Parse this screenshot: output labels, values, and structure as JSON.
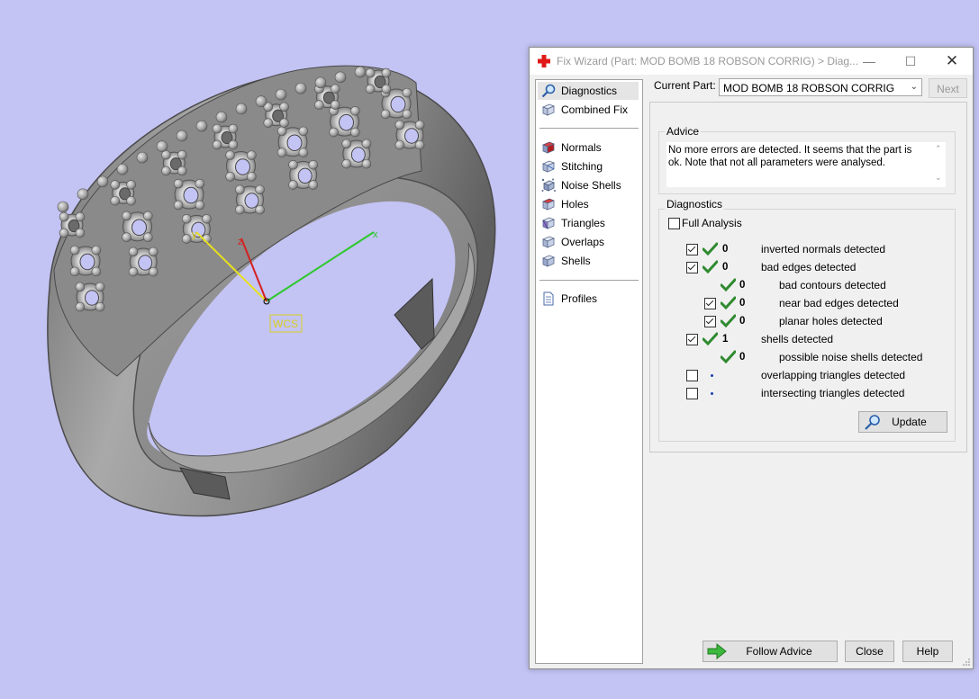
{
  "viewport": {
    "wcs_label": "WCS",
    "axis_x_label": "x",
    "axis_y_label": "y",
    "axis_z_label": "z"
  },
  "dialog": {
    "title": "Fix Wizard (Part: MOD  BOMB 18 ROBSON CORRIG) > Diag...",
    "nav": [
      {
        "label": "Diagnostics",
        "icon": "magnifier-icon",
        "selected": true
      },
      {
        "label": "Combined Fix",
        "icon": "cube-icon"
      },
      {
        "label": "Normals",
        "icon": "normals-cube-icon"
      },
      {
        "label": "Stitching",
        "icon": "stitching-cube-icon"
      },
      {
        "label": "Noise Shells",
        "icon": "noise-shells-icon"
      },
      {
        "label": "Holes",
        "icon": "holes-cube-icon"
      },
      {
        "label": "Triangles",
        "icon": "triangles-cube-icon"
      },
      {
        "label": "Overlaps",
        "icon": "overlaps-cube-icon"
      },
      {
        "label": "Shells",
        "icon": "shells-cube-icon"
      },
      {
        "label": "Profiles",
        "icon": "document-icon"
      }
    ],
    "current_part_label": "Current Part:",
    "current_part_value": "MOD  BOMB 18 ROBSON CORRIG",
    "next_label": "Next",
    "advice": {
      "title": "Advice",
      "text": "No more errors are detected. It seems that the part is ok. Note that not all parameters were analysed."
    },
    "diagnostics": {
      "title": "Diagnostics",
      "full_analysis_label": "Full Analysis",
      "full_analysis_checked": false,
      "rows": [
        {
          "checked": true,
          "status": "ok",
          "count": "0",
          "label": "inverted normals detected"
        },
        {
          "checked": true,
          "status": "ok",
          "count": "0",
          "label": "bad edges detected"
        },
        {
          "status": "ok",
          "count": "0",
          "label": "bad contours detected"
        },
        {
          "checked": true,
          "status": "ok",
          "count": "0",
          "label": "near bad edges detected"
        },
        {
          "checked": true,
          "status": "ok",
          "count": "0",
          "label": "planar holes detected"
        },
        {
          "checked": true,
          "status": "ok",
          "count": "1",
          "label": "shells detected"
        },
        {
          "status": "ok",
          "count": "0",
          "label": "possible noise shells detected"
        },
        {
          "checked": false,
          "status": "not-analysed",
          "label": "overlapping triangles detected"
        },
        {
          "checked": false,
          "status": "not-analysed",
          "label": "intersecting triangles detected"
        }
      ],
      "update_label": "Update"
    },
    "buttons": {
      "follow_advice": "Follow Advice",
      "close": "Close",
      "help": "Help"
    },
    "colors": {
      "viewport_bg": "#c3c3f4",
      "check_green": "#2f8a2f",
      "x_axis": "#2ec82e",
      "y_axis": "#e8e020",
      "z_axis": "#d62020"
    }
  }
}
